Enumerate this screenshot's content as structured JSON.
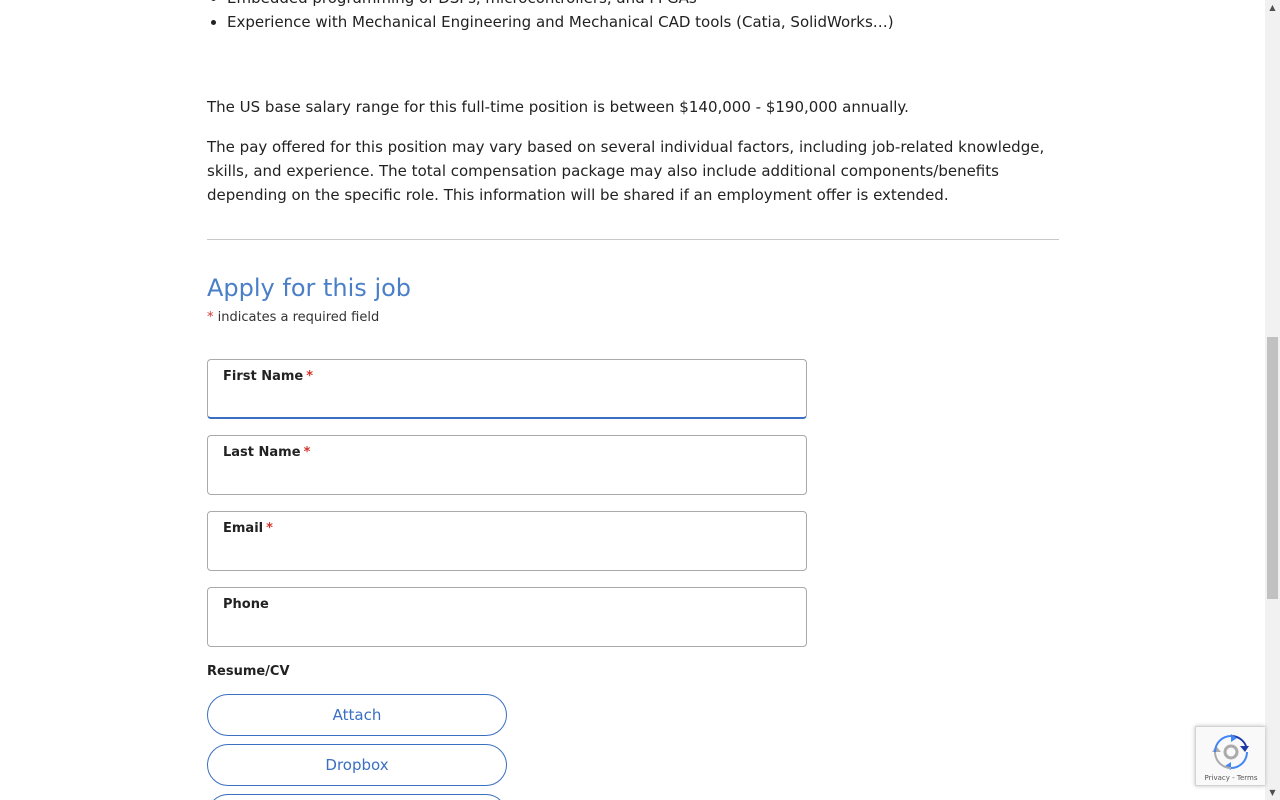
{
  "description": {
    "qualifications": [
      "Embedded programming of DSPs, microcontrollers, and FPGAs",
      "Experience with Mechanical Engineering and Mechanical CAD tools (Catia, SolidWorks…)"
    ],
    "salary_text": "The US base salary range for this full-time position is between $140,000 - $190,000 annually.",
    "pay_text": "The pay offered for this position may vary based on several individual factors, including job-related knowledge, skills, and experience. The total compensation package may also include additional components/benefits depending on the specific role. This information will be shared if an employment offer is extended."
  },
  "application": {
    "title": "Apply for this job",
    "required_star": "*",
    "required_note": "indicates a required field",
    "fields": [
      {
        "label": "First Name",
        "required": true,
        "value": ""
      },
      {
        "label": "Last Name",
        "required": true,
        "value": ""
      },
      {
        "label": "Email",
        "required": true,
        "value": ""
      },
      {
        "label": "Phone",
        "required": false,
        "value": ""
      }
    ],
    "resume_label": "Resume/CV",
    "buttons": {
      "attach": "Attach",
      "dropbox": "Dropbox"
    }
  },
  "recaptcha": {
    "terms": "Privacy - Terms"
  },
  "colors": {
    "accent": "#3a6fc2",
    "title": "#4a7fc8",
    "required": "#d0342c"
  },
  "icons": {
    "scroll_up": "triangle-up",
    "scroll_down": "triangle-down",
    "recaptcha": "recaptcha-logo"
  }
}
